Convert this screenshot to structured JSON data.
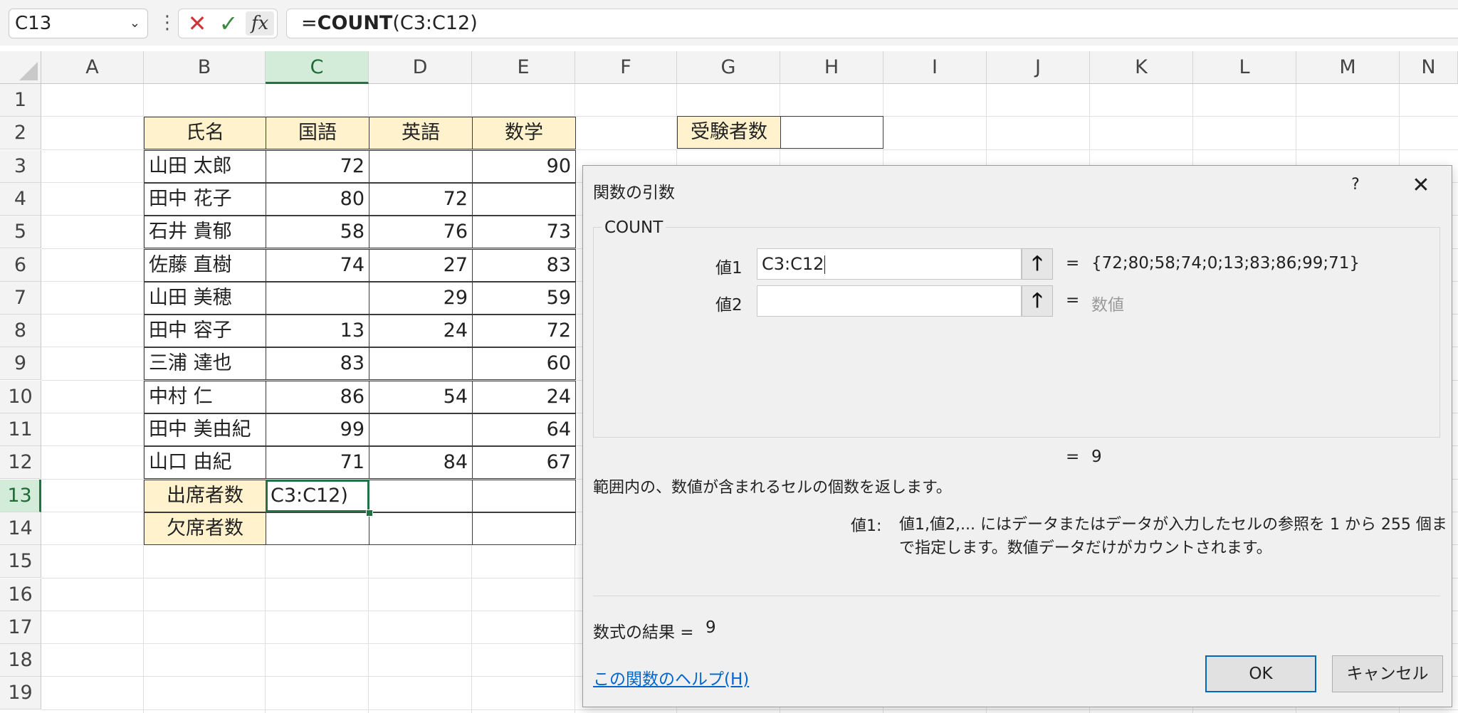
{
  "formula_bar": {
    "name_box": "C13",
    "formula_prefix": "=",
    "formula_func": "COUNT",
    "formula_args": "(C3:C12)",
    "fx_label": "fx"
  },
  "columns": [
    "A",
    "B",
    "C",
    "D",
    "E",
    "F",
    "G",
    "H",
    "I",
    "J",
    "K",
    "L",
    "M",
    "N"
  ],
  "rows": [
    "1",
    "2",
    "3",
    "4",
    "5",
    "6",
    "7",
    "8",
    "9",
    "10",
    "11",
    "12",
    "13",
    "14",
    "15",
    "16",
    "17",
    "18",
    "19"
  ],
  "table": {
    "headers": [
      "氏名",
      "国語",
      "英語",
      "数学"
    ],
    "rows": [
      {
        "name": "山田 太郎",
        "kokugo": "72",
        "eigo": "",
        "sugaku": "90"
      },
      {
        "name": "田中 花子",
        "kokugo": "80",
        "eigo": "72",
        "sugaku": ""
      },
      {
        "name": "石井 貴郁",
        "kokugo": "58",
        "eigo": "76",
        "sugaku": "73"
      },
      {
        "name": "佐藤 直樹",
        "kokugo": "74",
        "eigo": "27",
        "sugaku": "83"
      },
      {
        "name": "山田 美穂",
        "kokugo": "",
        "eigo": "29",
        "sugaku": "59"
      },
      {
        "name": "田中 容子",
        "kokugo": "13",
        "eigo": "24",
        "sugaku": "72"
      },
      {
        "name": "三浦 達也",
        "kokugo": "83",
        "eigo": "",
        "sugaku": "60"
      },
      {
        "name": "中村 仁",
        "kokugo": "86",
        "eigo": "54",
        "sugaku": "24"
      },
      {
        "name": "田中 美由紀",
        "kokugo": "99",
        "eigo": "",
        "sugaku": "64"
      },
      {
        "name": "山口 由紀",
        "kokugo": "71",
        "eigo": "84",
        "sugaku": "67"
      }
    ],
    "attendance_label": "出席者数",
    "absence_label": "欠席者数",
    "active_cell_text": "C3:C12)"
  },
  "examinee": {
    "label": "受験者数",
    "value": ""
  },
  "dialog": {
    "title": "関数の引数",
    "help_glyph": "?",
    "close_glyph": "✕",
    "function_name": "COUNT",
    "args": [
      {
        "label": "値1",
        "value": "C3:C12",
        "eq": "=",
        "result": "{72;80;58;74;0;13;83;86;99;71}"
      },
      {
        "label": "値2",
        "value": "",
        "eq": "=",
        "result": "数値"
      }
    ],
    "mid_eq": "=",
    "mid_result": "9",
    "description": "範囲内の、数値が含まれるセルの個数を返します。",
    "param_label": "値1:",
    "param_desc": "値1,値2,... にはデータまたはデータが入力したセルの参照を 1 から 255 個まで指定します。数値データだけがカウントされます。",
    "formula_result_label": "数式の結果 =",
    "formula_result_value": "9",
    "help_link": "この関数のヘルプ(H)",
    "ok_label": "OK",
    "cancel_label": "キャンセル"
  }
}
